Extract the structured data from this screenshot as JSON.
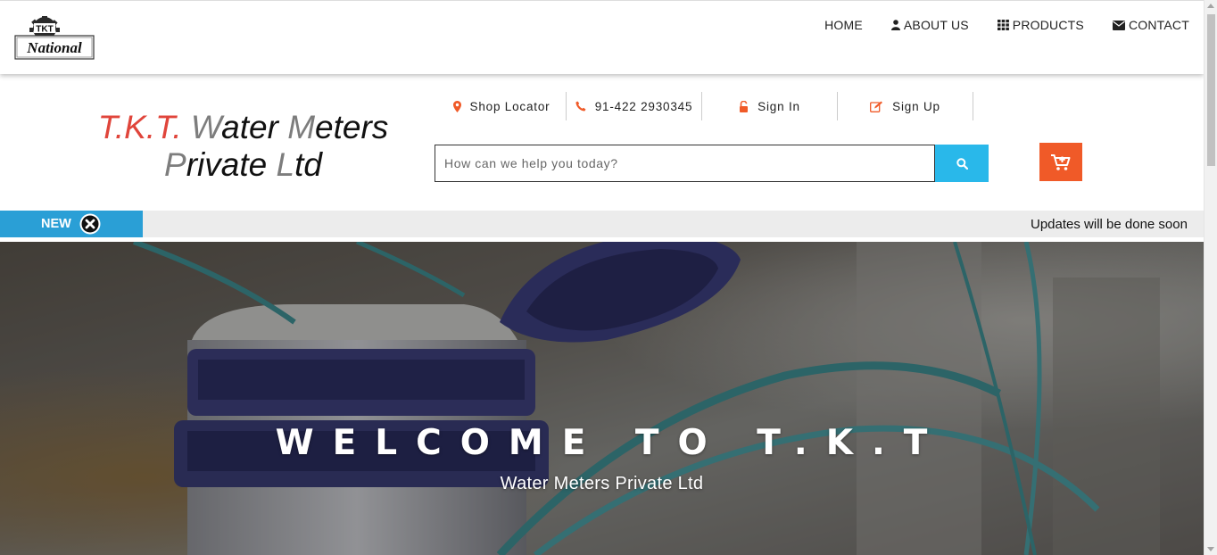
{
  "logo": {
    "top_text": "TKT",
    "script_text": "National"
  },
  "nav": {
    "home": "HOME",
    "about": "ABOUT US",
    "products": "PRODUCTS",
    "contact": "CONTACT"
  },
  "company": {
    "part1": "T.K.T.",
    "w": "W",
    "ater": "ater",
    "m": "M",
    "eters": "eters",
    "p": "P",
    "rivate": "rivate",
    "l": "L",
    "td": "td"
  },
  "infobar": {
    "shop_locator": "Shop Locator",
    "phone": "91-422 2930345",
    "sign_in": "Sign In",
    "sign_up": "Sign Up"
  },
  "search": {
    "placeholder": "How can we help you today?"
  },
  "ticker": {
    "label": "NEW",
    "message": "Updates will be done soon"
  },
  "hero": {
    "title": "WELCOME TO T.K.T",
    "subtitle": "Water Meters Private Ltd"
  },
  "colors": {
    "accent_red": "#e0453b",
    "search_blue": "#29b8ea",
    "cart_orange": "#f05a28",
    "ticker_blue": "#2a9fd6"
  }
}
